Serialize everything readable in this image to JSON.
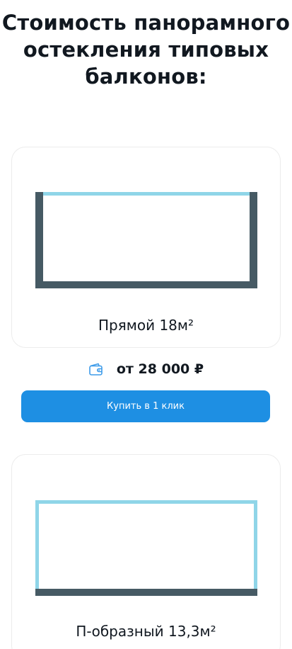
{
  "heading": {
    "line1": "Стоимость панорамного",
    "line2": "остекления типовых",
    "line3": "балконов:"
  },
  "cards": [
    {
      "title": "Прямой 18м²",
      "price": "от 28 000 ₽",
      "price_icon": "wallet-icon",
      "button_label": "Купить в 1 клик"
    },
    {
      "title": "П-образный 13,3м²"
    }
  ],
  "colors": {
    "wall": "#465a64",
    "glass": "#8fd5e8",
    "button": "#1e8fe3",
    "icon": "#3d9be9"
  }
}
